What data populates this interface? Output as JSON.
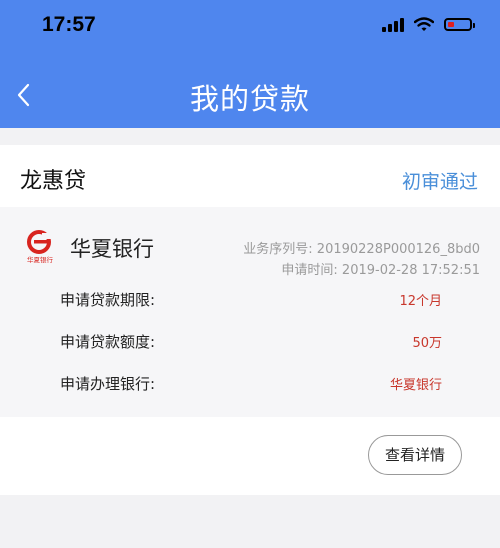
{
  "status_bar": {
    "time": "17:57"
  },
  "header": {
    "title": "我的贷款"
  },
  "loan": {
    "product_name": "龙惠贷",
    "status": "初审通过",
    "bank": {
      "logo_text": "华夏银行",
      "name": "华夏银行",
      "serial": "业务序列号: 20190228P000126_8bd0",
      "apply_time": "申请时间: 2019-02-28 17:52:51"
    },
    "rows": [
      {
        "label": "申请贷款期限:",
        "value": "12个月"
      },
      {
        "label": "申请贷款额度:",
        "value": "50万"
      },
      {
        "label": "申请办理银行:",
        "value": "华夏银行"
      }
    ],
    "detail_button": "查看详情"
  },
  "colors": {
    "header_bg": "#4f86ee",
    "status_blue": "#4a8fd9",
    "value_red": "#c8372c",
    "logo_red": "#d8241f"
  }
}
